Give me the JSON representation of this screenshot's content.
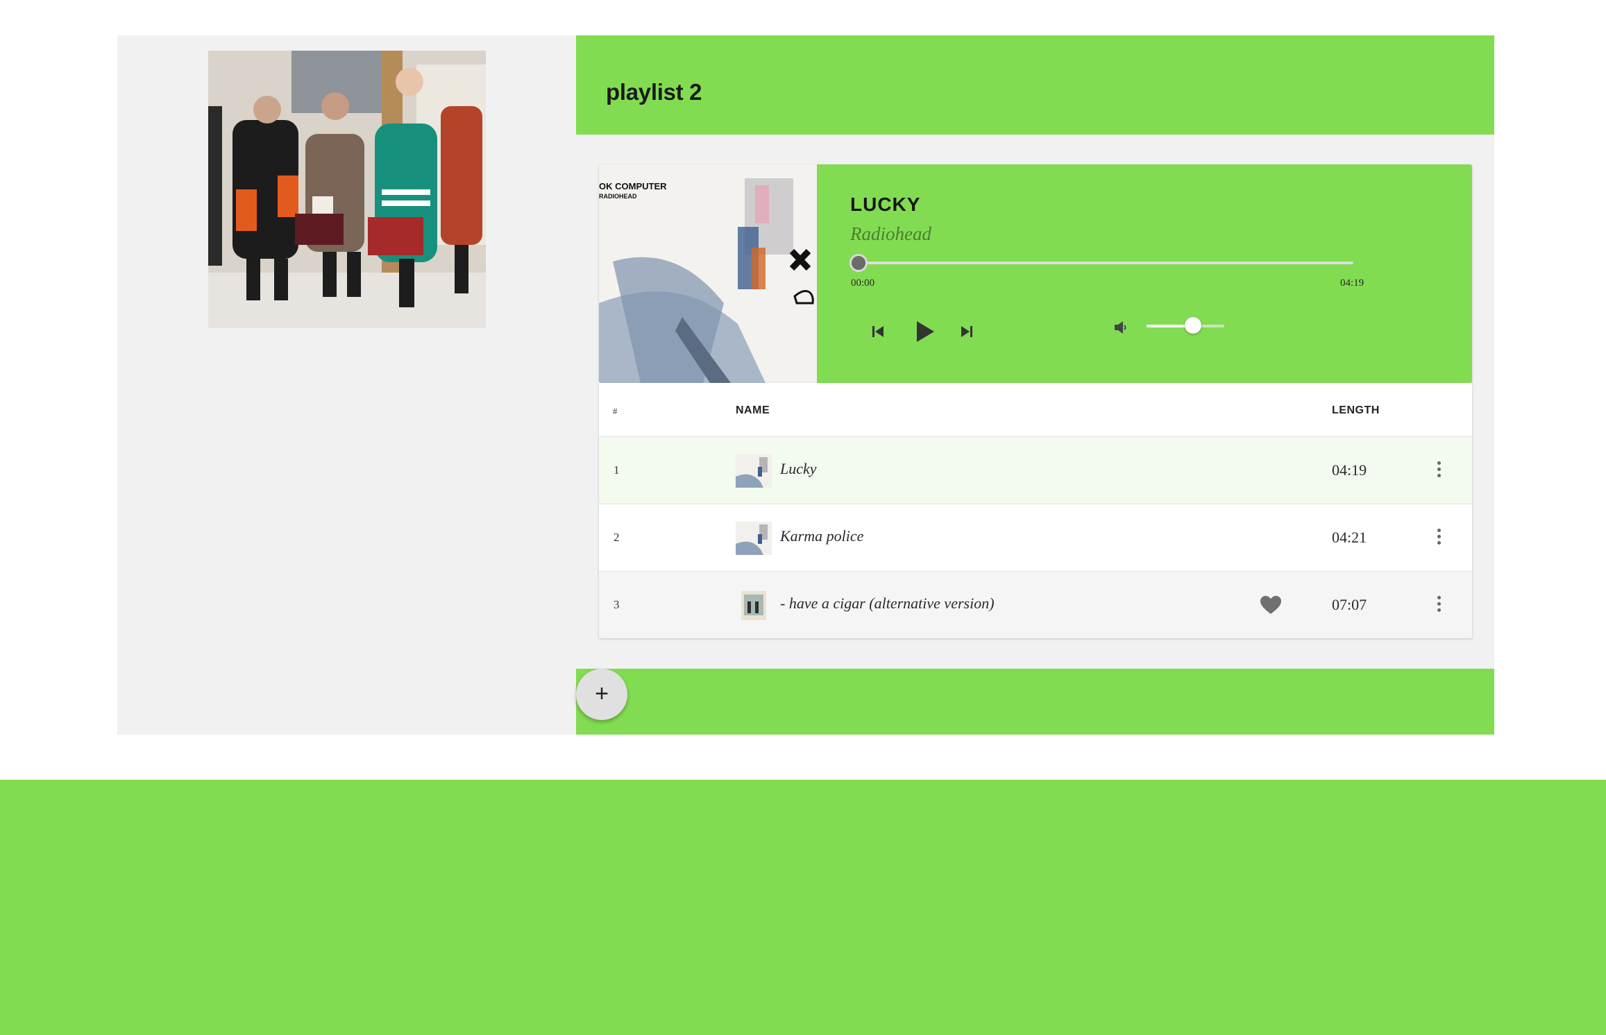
{
  "playlist": {
    "title": "playlist 2"
  },
  "player": {
    "album_art_title": "OK COMPUTER",
    "album_art_artist": "RADIOHEAD",
    "track_title": "LUCKY",
    "artist": "Radiohead",
    "time_elapsed": "00:00",
    "time_total": "04:19",
    "progress_fraction": 0.0,
    "volume_fraction": 0.6,
    "controls": {
      "prev_icon": "skip-previous-icon",
      "play_icon": "play-icon",
      "next_icon": "skip-next-icon",
      "volume_icon": "volume-icon"
    }
  },
  "table": {
    "headers": {
      "number": "#",
      "name": "NAME",
      "length": "LENGTH"
    },
    "rows": [
      {
        "number": "1",
        "name": "Lucky",
        "length": "04:19",
        "liked": false,
        "highlighted": true
      },
      {
        "number": "2",
        "name": "Karma police",
        "length": "04:21",
        "liked": false,
        "highlighted": false
      },
      {
        "number": "3",
        "name": "- have a cigar (alternative version)",
        "length": "07:07",
        "liked": true,
        "highlighted": false
      }
    ]
  },
  "actions": {
    "add_label": "+"
  },
  "colors": {
    "accent": "#82dc51",
    "panel": "#f1f1f1",
    "highlight_row": "#f3faee",
    "alt_row": "#f5f5f5"
  }
}
